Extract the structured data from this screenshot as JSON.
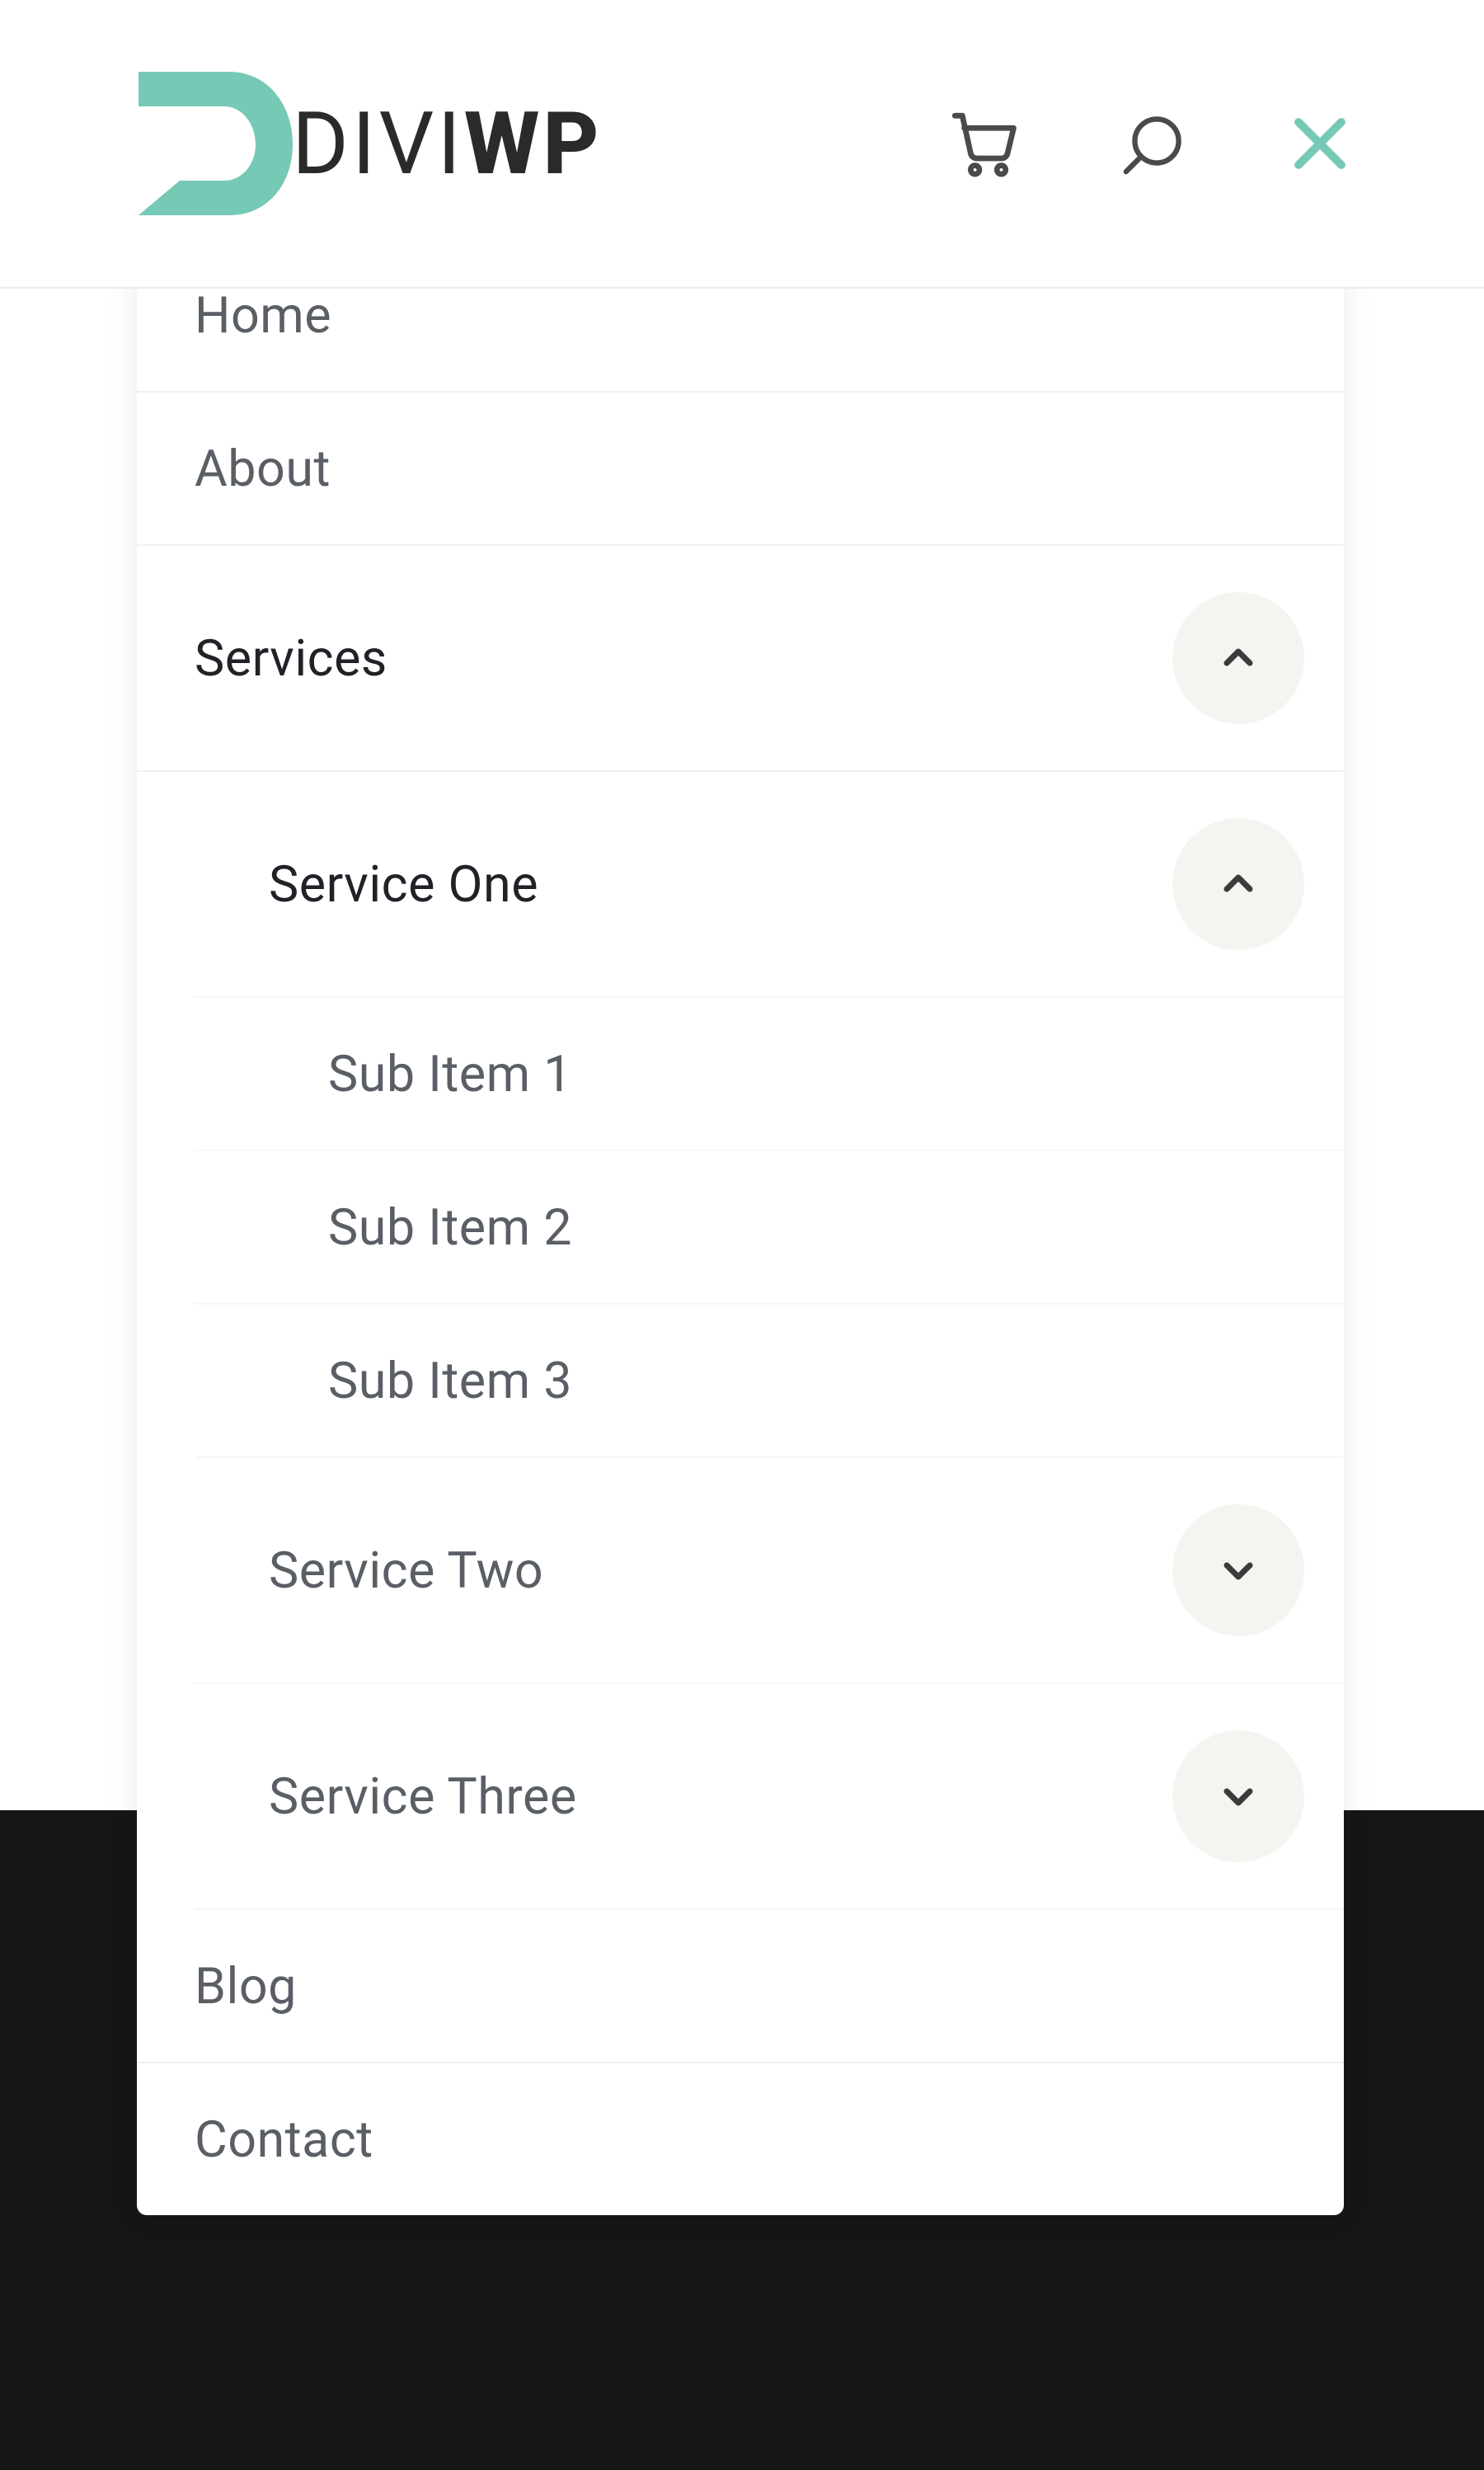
{
  "brand": {
    "name_part1": "DIVI",
    "name_part2": "WP",
    "accent_color": "#76c9b5"
  },
  "menu": {
    "items": [
      {
        "label": "Home"
      },
      {
        "label": "About"
      },
      {
        "label": "Services",
        "active": true,
        "expanded": true,
        "children": [
          {
            "label": "Service One",
            "active": true,
            "expanded": true,
            "children": [
              {
                "label": "Sub Item 1"
              },
              {
                "label": "Sub Item 2"
              },
              {
                "label": "Sub Item 3"
              }
            ]
          },
          {
            "label": "Service Two",
            "expanded": false
          },
          {
            "label": "Service Three",
            "expanded": false
          }
        ]
      },
      {
        "label": "Blog"
      },
      {
        "label": "Contact"
      }
    ]
  }
}
